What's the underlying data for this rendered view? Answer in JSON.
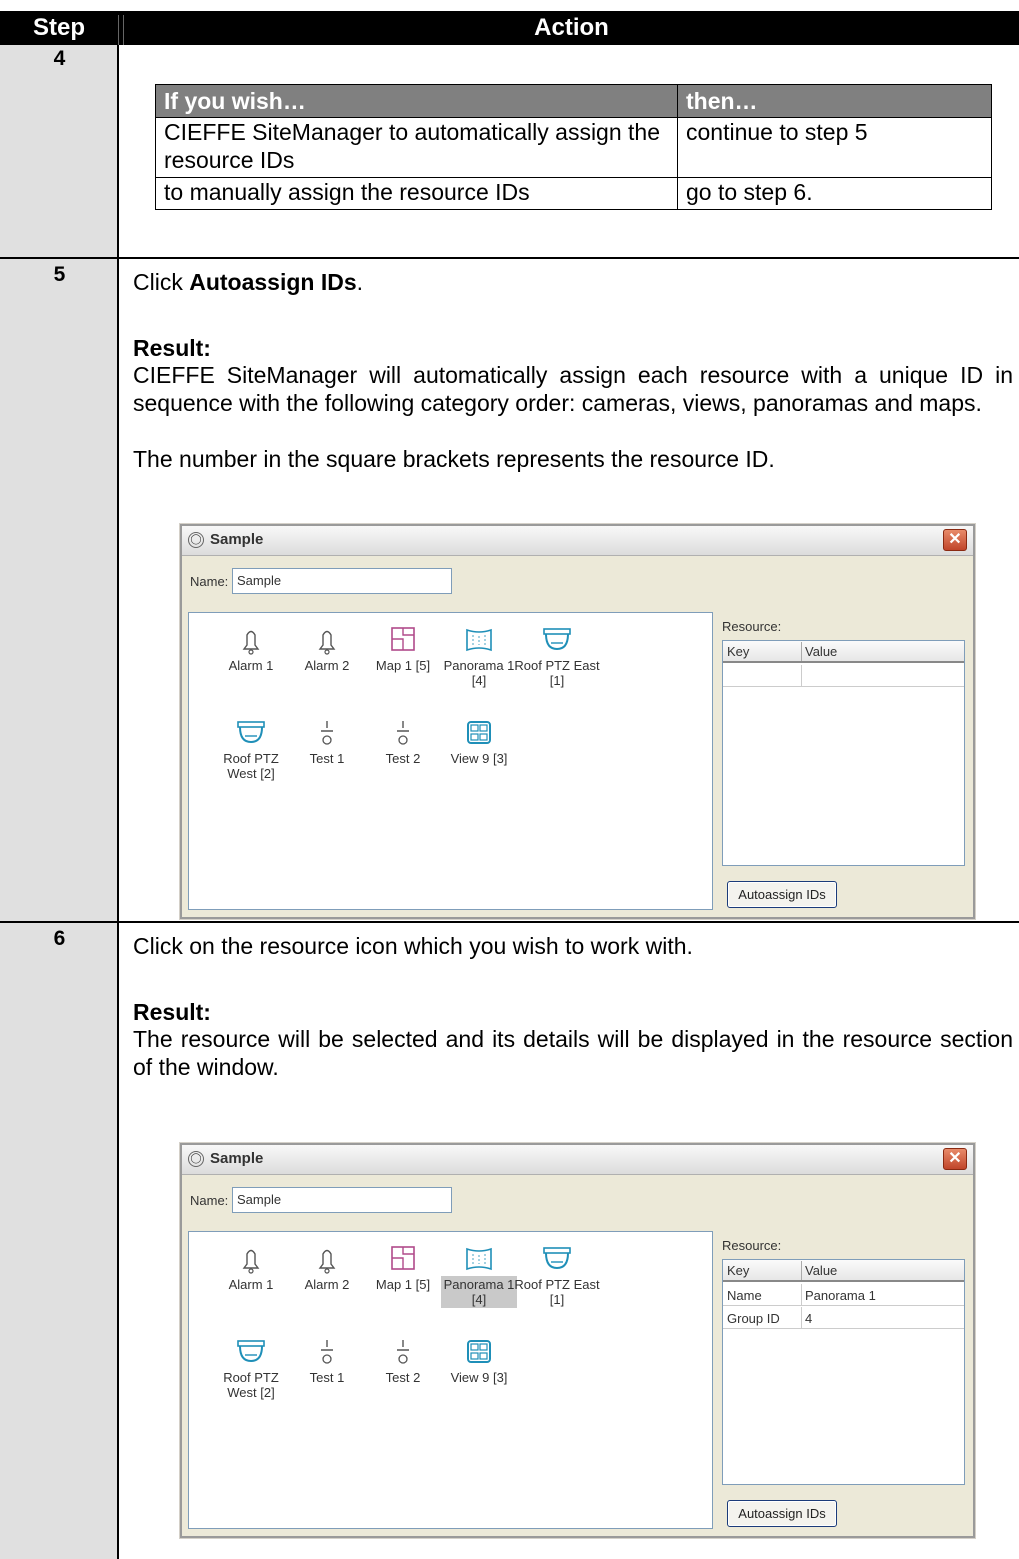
{
  "header": {
    "step": "Step",
    "action": "Action"
  },
  "step4": {
    "number": "4",
    "table": {
      "col1": "If you wish…",
      "col2": "then…",
      "rows": [
        {
          "wish": "CIEFFE SiteManager to automatically assign the resource IDs",
          "then": "continue to step 5"
        },
        {
          "wish": "to manually assign the resource IDs",
          "then": "go to step 6."
        }
      ]
    }
  },
  "step5": {
    "number": "5",
    "click_prefix": "Click ",
    "click_target": "Autoassign IDs",
    "click_suffix": ".",
    "result_label": "Result:",
    "result_text": "CIEFFE SiteManager will automatically assign each resource with a unique ID in sequence with the following category order: cameras, views, panoramas and maps.",
    "note": "The number in the square brackets represents the resource ID."
  },
  "step6": {
    "number": "6",
    "instruction": "Click on the resource icon which you wish to work with.",
    "result_label": "Result:",
    "result_text": "The resource will be selected and its details will be displayed in the resource section of the window."
  },
  "window": {
    "title": "Sample",
    "name_label": "Name:",
    "name_value": "Sample",
    "resource_label": "Resource:",
    "key_header": "Key",
    "value_header": "Value",
    "autoassign_button": "Autoassign IDs",
    "resources": [
      {
        "label": "Alarm 1",
        "icon": "bell-icon"
      },
      {
        "label": "Alarm 2",
        "icon": "bell-icon"
      },
      {
        "label": "Map 1 [5]",
        "icon": "map-icon"
      },
      {
        "label": "Panorama 1\n[4]",
        "icon": "panorama-icon"
      },
      {
        "label": "Roof PTZ East\n[1]",
        "icon": "ptz-camera-icon"
      },
      {
        "label": "Roof PTZ\nWest [2]",
        "icon": "ptz-camera-icon"
      },
      {
        "label": "Test 1",
        "icon": "sensor-icon"
      },
      {
        "label": "Test 2",
        "icon": "sensor-icon"
      },
      {
        "label": "View 9 [3]",
        "icon": "view-grid-icon"
      }
    ],
    "selected_details": [
      {
        "key": "Name",
        "value": "Panorama 1"
      },
      {
        "key": "Group ID",
        "value": "4"
      }
    ]
  },
  "colors": {
    "header_bg": "#000000",
    "step_col_bg": "#e0e0e0",
    "decision_header_bg": "#808080",
    "icon_blue": "#1f8fb8",
    "icon_magenta": "#b04a8a"
  }
}
